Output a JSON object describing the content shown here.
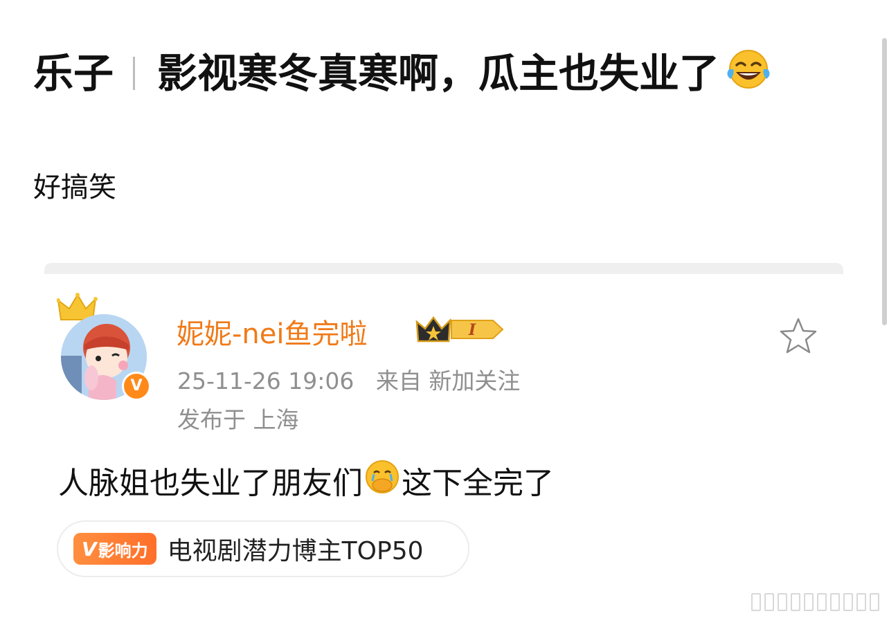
{
  "header": {
    "category": "乐子",
    "title": "影视寒冬真寒啊，瓜主也失业了",
    "emoji_icon": "tears-of-joy-emoji"
  },
  "subtitle": "好搞笑",
  "post": {
    "username": "妮妮-nei鱼完啦",
    "level_badge": "I",
    "date": "25-11-26 19:06",
    "source_prefix": "来自",
    "source": "新加关注",
    "location_prefix": "发布于",
    "location": "上海",
    "content_before": "人脉姐也失业了朋友们",
    "content_emoji": "crying-hands-over-mouth-emoji",
    "content_after": "这下全完了",
    "tag_badge_v": "V",
    "tag_badge_text": "影响力",
    "tag_text": "电视剧潜力博主TOP50"
  },
  "colors": {
    "username": "#f07a18",
    "meta": "#8f8f8f",
    "tag_orange": "#ff7a30"
  }
}
